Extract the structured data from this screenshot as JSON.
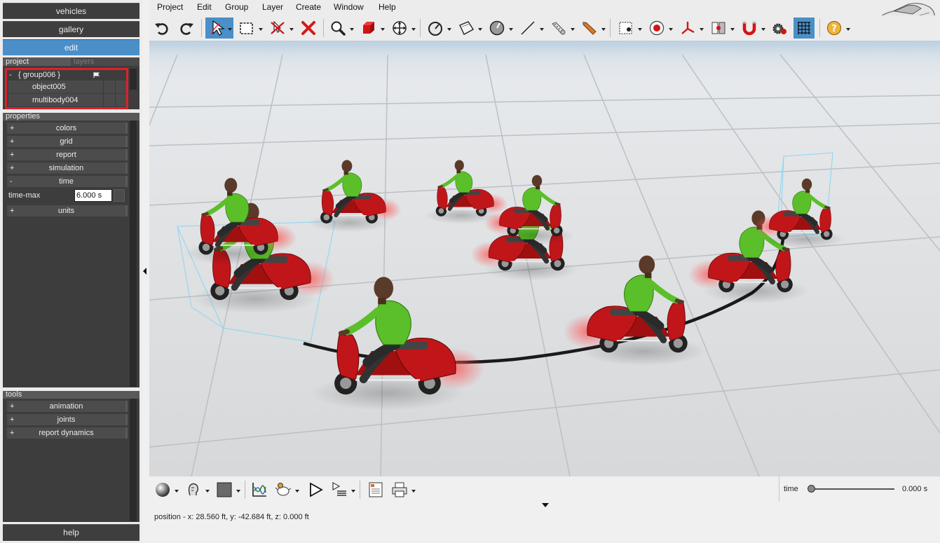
{
  "nav": {
    "vehicles": "vehicles",
    "gallery": "gallery",
    "edit": "edit"
  },
  "project_tabs": {
    "project": "project",
    "layers": "layers"
  },
  "tree": {
    "group_toggle": "-",
    "group": "{ group006 }",
    "items": [
      "object005",
      "multibody004"
    ]
  },
  "properties": {
    "header": "properties",
    "sections": [
      {
        "toggle": "+",
        "label": "colors"
      },
      {
        "toggle": "+",
        "label": "grid"
      },
      {
        "toggle": "+",
        "label": "report"
      },
      {
        "toggle": "+",
        "label": "simulation"
      },
      {
        "toggle": "-",
        "label": "time"
      }
    ],
    "time_max_label": "time-max",
    "time_max_value": "6.000 s",
    "units": {
      "toggle": "+",
      "label": "units"
    }
  },
  "tools": {
    "header": "tools",
    "sections": [
      {
        "toggle": "+",
        "label": "animation"
      },
      {
        "toggle": "+",
        "label": "joints"
      },
      {
        "toggle": "+",
        "label": "report dynamics"
      }
    ]
  },
  "help": "help",
  "menu": [
    "Project",
    "Edit",
    "Group",
    "Layer",
    "Create",
    "Window",
    "Help"
  ],
  "time": {
    "label": "time",
    "value": "0.000 s",
    "fraction": 0.0
  },
  "status": "position - x: 28.560 ft, y: -42.684 ft, z: 0.000 ft",
  "colors": {
    "accent": "#4a8fc8",
    "highlight": "#e0202a",
    "scooter": "#c0161a",
    "shirt": "#5bbf2a"
  }
}
